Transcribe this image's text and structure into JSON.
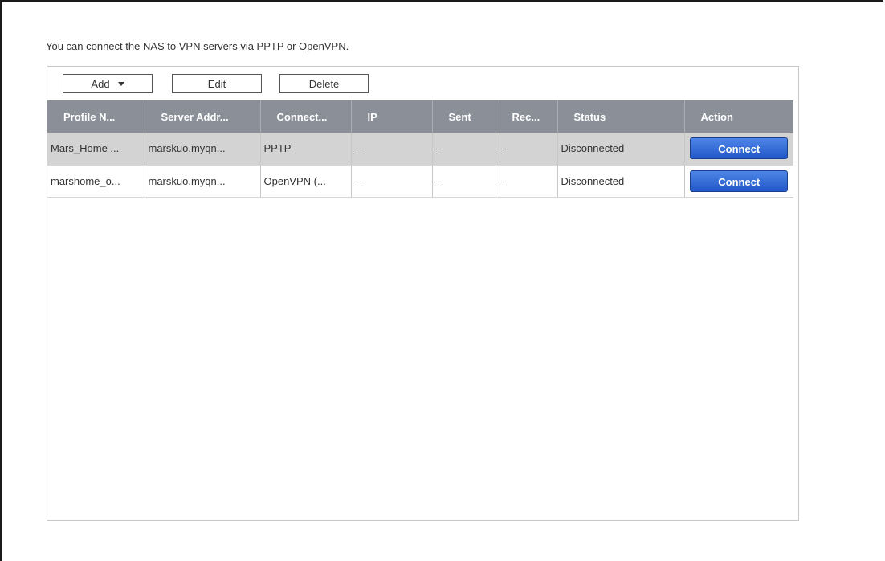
{
  "intro_text": "You can connect the NAS to VPN servers via PPTP or OpenVPN.",
  "toolbar": {
    "add_label": "Add",
    "edit_label": "Edit",
    "delete_label": "Delete"
  },
  "table": {
    "columns": [
      "Profile N...",
      "Server Addr...",
      "Connect...",
      "IP",
      "Sent",
      "Rec...",
      "Status",
      "Action"
    ],
    "rows": [
      {
        "profile": "Mars_Home ...",
        "server": "marskuo.myqn...",
        "connection": "PPTP",
        "ip": "--",
        "sent": "--",
        "received": "--",
        "status": "Disconnected",
        "action": "Connect",
        "selected": true
      },
      {
        "profile": "marshome_o...",
        "server": "marskuo.myqn...",
        "connection": "OpenVPN (...",
        "ip": "--",
        "sent": "--",
        "received": "--",
        "status": "Disconnected",
        "action": "Connect",
        "selected": false
      }
    ]
  },
  "colors": {
    "header_bg": "#8a8f98",
    "selected_row_bg": "#d3d3d3",
    "connect_button": "#2f68d6"
  },
  "icons": {
    "add_dropdown": "caret-down-icon"
  }
}
